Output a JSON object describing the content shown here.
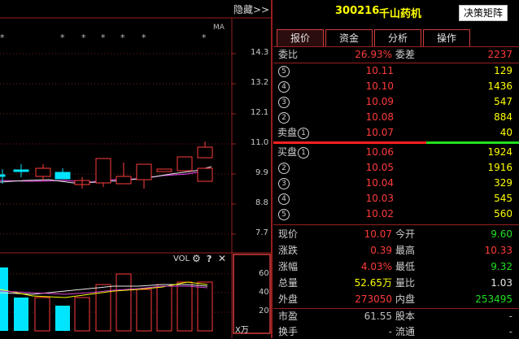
{
  "chart": {
    "hide_label": "隐藏>>",
    "ma_label": "MA",
    "marker_char": "*",
    "price_ticks": [
      "14.3",
      "13.2",
      "12.1",
      "11.0",
      "9.9",
      "8.8",
      "7.7"
    ],
    "vol_label": "VOL",
    "vol_ticks": [
      "60",
      "40",
      "20"
    ],
    "vol_unit": "X万"
  },
  "header": {
    "code": "300216",
    "name": "千山药机",
    "decision_button": "决策矩阵"
  },
  "tabs": [
    {
      "label": "报价",
      "active": true
    },
    {
      "label": "资金",
      "active": false
    },
    {
      "label": "分析",
      "active": false
    },
    {
      "label": "操作",
      "active": false
    }
  ],
  "ratio": {
    "wb_label": "委比",
    "wb_value": "26.93%",
    "wc_label": "委差",
    "wc_value": "2237"
  },
  "asks": [
    {
      "label": "",
      "num": "5",
      "price": "10.11",
      "vol": "129"
    },
    {
      "label": "",
      "num": "4",
      "price": "10.10",
      "vol": "1436"
    },
    {
      "label": "",
      "num": "3",
      "price": "10.09",
      "vol": "547"
    },
    {
      "label": "",
      "num": "2",
      "price": "10.08",
      "vol": "884"
    },
    {
      "label": "卖盘",
      "num": "1",
      "price": "10.07",
      "vol": "40"
    }
  ],
  "bids": [
    {
      "label": "买盘",
      "num": "1",
      "price": "10.06",
      "vol": "1924"
    },
    {
      "label": "",
      "num": "2",
      "price": "10.05",
      "vol": "1916"
    },
    {
      "label": "",
      "num": "3",
      "price": "10.04",
      "vol": "329"
    },
    {
      "label": "",
      "num": "4",
      "price": "10.03",
      "vol": "545"
    },
    {
      "label": "",
      "num": "5",
      "price": "10.02",
      "vol": "560"
    }
  ],
  "quote": [
    {
      "l1": "现价",
      "v1": "10.07",
      "c1": "red",
      "l2": "今开",
      "v2": "9.60",
      "c2": "green"
    },
    {
      "l1": "涨跌",
      "v1": "0.39",
      "c1": "red",
      "l2": "最高",
      "v2": "10.33",
      "c2": "red"
    },
    {
      "l1": "涨幅",
      "v1": "4.03%",
      "c1": "red",
      "l2": "最低",
      "v2": "9.32",
      "c2": "green"
    },
    {
      "l1": "总量",
      "v1": "52.65万",
      "c1": "yellow",
      "l2": "量比",
      "v2": "1.03",
      "c2": "white"
    },
    {
      "l1": "外盘",
      "v1": "273050",
      "c1": "red",
      "l2": "内盘",
      "v2": "253495",
      "c2": "green"
    },
    {
      "l1": "市盈",
      "v1": "61.55",
      "c1": "gray",
      "l2": "股本",
      "v2": "-",
      "c2": "gray"
    },
    {
      "l1": "换手",
      "v1": "-",
      "c1": "gray",
      "l2": "流通",
      "v2": "-",
      "c2": "gray"
    }
  ],
  "colors": {
    "up": "#ff3b3b",
    "down": "#21e021",
    "volume": "#ffff00",
    "border": "#9a1f1f",
    "up_fill": "#00e5ff"
  }
}
